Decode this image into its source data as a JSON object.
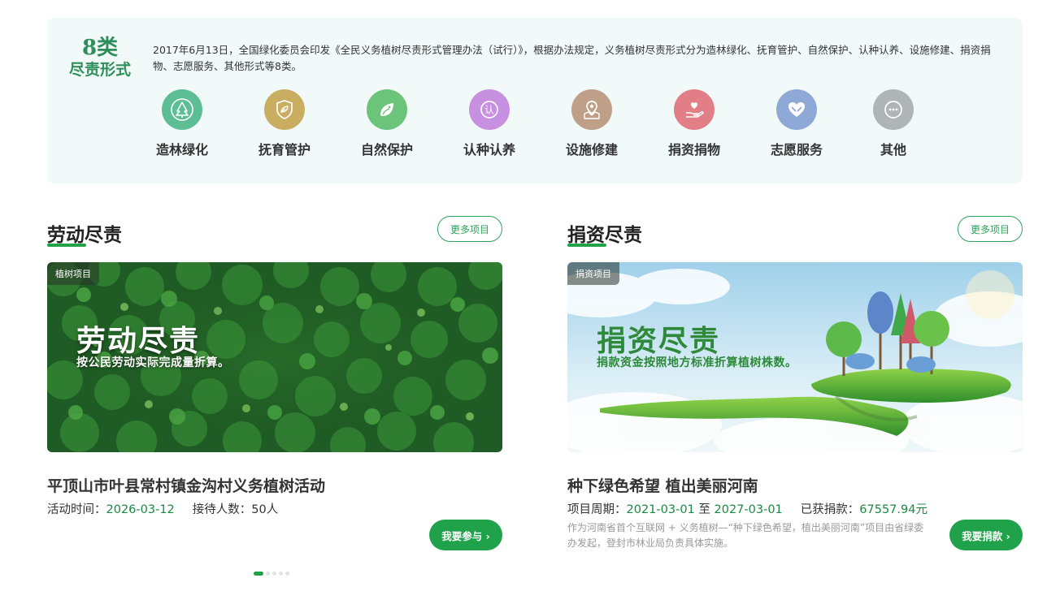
{
  "types": {
    "badge_line1": "8类",
    "badge_line2": "尽责形式",
    "description": "2017年6月13日，全国绿化委员会印发《全民义务植树尽责形式管理办法（试行）》，根据办法规定，义务植树尽责形式分为造林绿化、抚育管护、自然保护、认种认养、设施修建、捐资捐物、志愿服务、其他形式等8类。",
    "items": [
      {
        "label": "造林绿化",
        "icon": "tree-icon",
        "color": "#5dbd95"
      },
      {
        "label": "抚育管护",
        "icon": "shield-leaf-icon",
        "color": "#c9ae62"
      },
      {
        "label": "自然保护",
        "icon": "bird-leaf-icon",
        "color": "#6cc37a"
      },
      {
        "label": "认种认养",
        "icon": "adopt-icon",
        "color": "#c890e0"
      },
      {
        "label": "设施修建",
        "icon": "map-pin-icon",
        "color": "#bf9f88"
      },
      {
        "label": "捐资捐物",
        "icon": "donate-hand-icon",
        "color": "#e27f86"
      },
      {
        "label": "志愿服务",
        "icon": "heart-hands-icon",
        "color": "#8fa9d6"
      },
      {
        "label": "其他",
        "icon": "more-icon",
        "color": "#aeb5b4"
      }
    ]
  },
  "labor": {
    "title": "劳动尽责",
    "more_label": "更多项目",
    "tag": "植树项目",
    "banner_title": "劳动尽责",
    "banner_sub": "按公民劳动实际完成量折算。",
    "item_title": "平顶山市叶县常村镇金沟村义务植树活动",
    "time_label": "活动时间：",
    "time_value": "2026-03-12",
    "people_label": "接待人数：",
    "people_value": "50人",
    "button_label": "我要参与 ›"
  },
  "donate": {
    "title": "捐资尽责",
    "more_label": "更多项目",
    "tag": "捐资项目",
    "banner_title": "捐资尽责",
    "banner_sub": "捐款资金按照地方标准折算植树株数。",
    "item_title": "种下绿色希望 植出美丽河南",
    "period_label": "项目周期：",
    "period_start": "2021-03-01",
    "period_sep": "至",
    "period_end": "2027-03-01",
    "amount_label": "已获捐款：",
    "amount_value": "67557.94元",
    "description": "作为河南省首个互联网 + 义务植树—“种下绿色希望，植出美丽河南”项目由省绿委办发起，登封市林业局负责具体实施。",
    "button_label": "我要捐款 ›"
  },
  "carousel": {
    "count": 5,
    "active": 0
  }
}
